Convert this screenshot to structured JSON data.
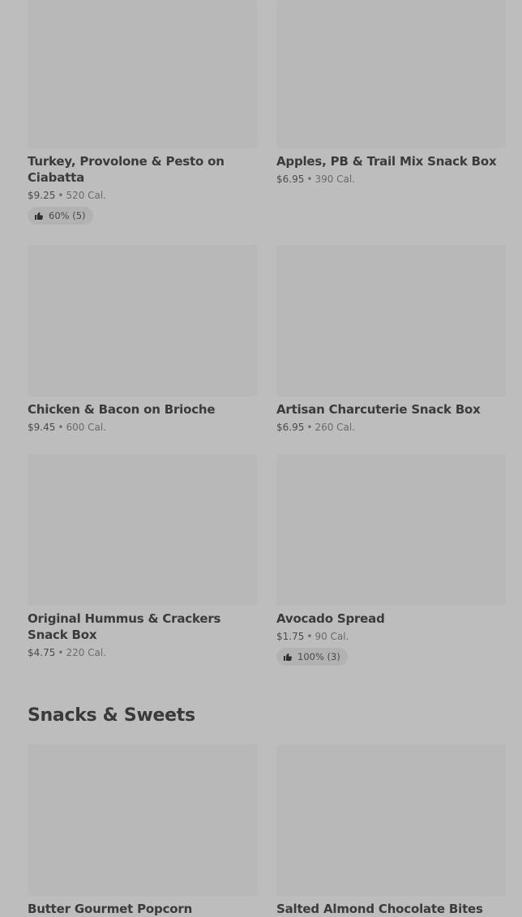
{
  "sections": [
    {
      "title": "",
      "items": [
        {
          "name": "Turkey, Provolone & Pesto on Ciabatta",
          "price": "$9.25",
          "calories": "520 Cal.",
          "rating": "60% (5)"
        },
        {
          "name": "Apples, PB & Trail Mix Snack Box",
          "price": "$6.95",
          "calories": "390 Cal.",
          "rating": ""
        },
        {
          "name": "Chicken & Bacon on Brioche",
          "price": "$9.45",
          "calories": "600 Cal.",
          "rating": ""
        },
        {
          "name": "Artisan Charcuterie Snack Box",
          "price": "$6.95",
          "calories": "260 Cal.",
          "rating": ""
        },
        {
          "name": "Original Hummus & Crackers Snack Box",
          "price": "$4.75",
          "calories": "220 Cal.",
          "rating": ""
        },
        {
          "name": "Avocado Spread",
          "price": "$1.75",
          "calories": "90 Cal.",
          "rating": "100% (3)"
        }
      ]
    },
    {
      "title": "Snacks & Sweets",
      "items": [
        {
          "name": "Butter Gourmet Popcorn"
        },
        {
          "name": "Salted Almond Chocolate Bites"
        }
      ]
    }
  ],
  "separator": "•",
  "icons": {
    "rating": "thumbs-up-icon"
  },
  "colors": {
    "overlay_background": "#bdbdbd",
    "image_placeholder": "#b8b8b8",
    "badge_background": "#b2b2b2"
  }
}
